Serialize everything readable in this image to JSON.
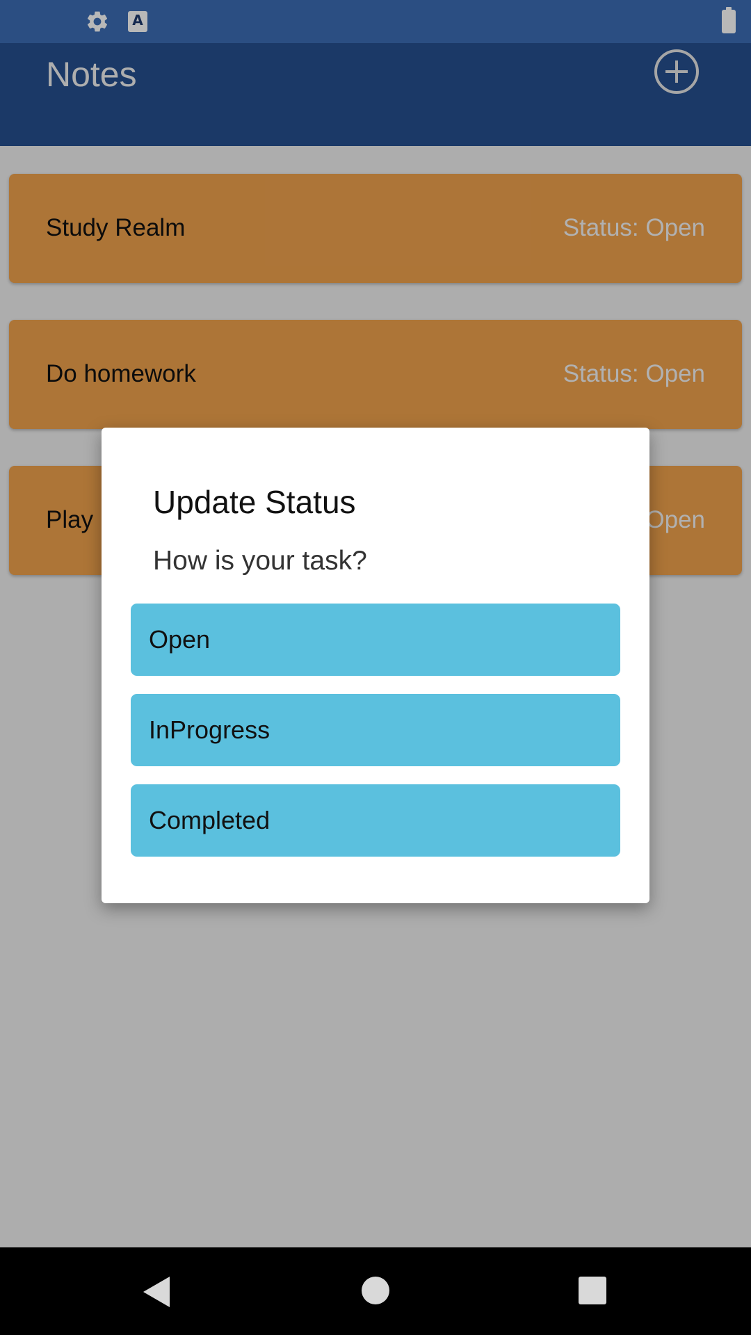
{
  "status_bar": {
    "icons": [
      "gear-icon",
      "text-a-icon",
      "battery-icon"
    ],
    "a_icon_glyph": "A"
  },
  "app_bar": {
    "title": "Notes",
    "add_icon": "plus-circle-icon"
  },
  "notes": [
    {
      "title": "Study Realm",
      "status": "Status: Open"
    },
    {
      "title": "Do homework",
      "status": "Status: Open"
    },
    {
      "title": "Play",
      "status": "Status: Open"
    }
  ],
  "dialog": {
    "title": "Update Status",
    "message": "How is your task?",
    "options": [
      "Open",
      "InProgress",
      "Completed"
    ]
  },
  "nav_bar": {
    "icons": [
      "back-icon",
      "home-icon",
      "recents-icon"
    ]
  },
  "colors": {
    "status_bar": "#3c6cb4",
    "app_bar": "#26508f",
    "card": "#f0a24d",
    "option_button": "#5bc0de",
    "dialog": "#ffffff"
  }
}
